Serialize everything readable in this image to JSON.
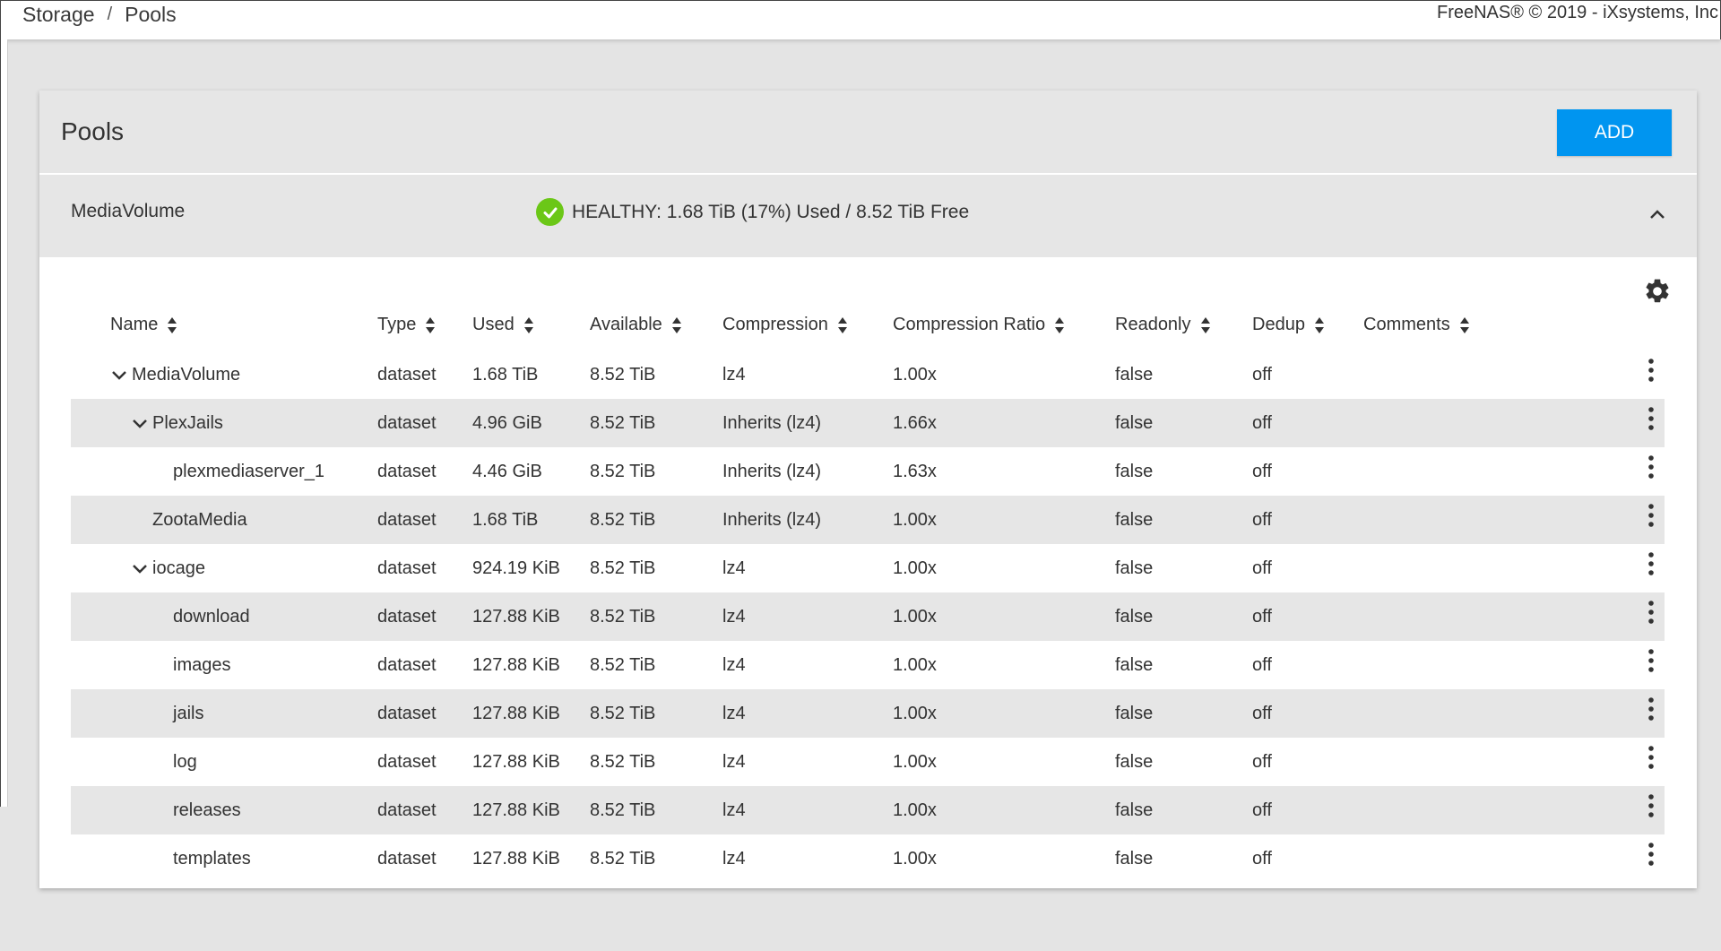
{
  "breadcrumb": {
    "items": [
      "Storage",
      "Pools"
    ],
    "separator": "/"
  },
  "copyright": "FreeNAS® © 2019 - iXsystems, Inc",
  "card": {
    "title": "Pools",
    "add_label": "ADD"
  },
  "pool": {
    "name": "MediaVolume",
    "status": "HEALTHY: 1.68 TiB (17%) Used / 8.52 TiB Free",
    "status_color": "#6bc717"
  },
  "colors": {
    "accent": "#0095f0",
    "header_bg": "#e6e6e6",
    "stripe": "#e6e6e6"
  },
  "columns": [
    "Name",
    "Type",
    "Used",
    "Available",
    "Compression",
    "Compression Ratio",
    "Readonly",
    "Dedup",
    "Comments"
  ],
  "rows": [
    {
      "name": "MediaVolume",
      "level": 0,
      "expander": true,
      "type": "dataset",
      "used": "1.68 TiB",
      "available": "8.52 TiB",
      "compression": "lz4",
      "ratio": "1.00x",
      "readonly": "false",
      "dedup": "off",
      "comments": ""
    },
    {
      "name": "PlexJails",
      "level": 1,
      "expander": true,
      "type": "dataset",
      "used": "4.96 GiB",
      "available": "8.52 TiB",
      "compression": "Inherits (lz4)",
      "ratio": "1.66x",
      "readonly": "false",
      "dedup": "off",
      "comments": ""
    },
    {
      "name": "plexmediaserver_1",
      "level": 2,
      "expander": false,
      "type": "dataset",
      "used": "4.46 GiB",
      "available": "8.52 TiB",
      "compression": "Inherits (lz4)",
      "ratio": "1.63x",
      "readonly": "false",
      "dedup": "off",
      "comments": ""
    },
    {
      "name": "ZootaMedia",
      "level": 1,
      "expander": false,
      "type": "dataset",
      "used": "1.68 TiB",
      "available": "8.52 TiB",
      "compression": "Inherits (lz4)",
      "ratio": "1.00x",
      "readonly": "false",
      "dedup": "off",
      "comments": ""
    },
    {
      "name": "iocage",
      "level": 1,
      "expander": true,
      "type": "dataset",
      "used": "924.19 KiB",
      "available": "8.52 TiB",
      "compression": "lz4",
      "ratio": "1.00x",
      "readonly": "false",
      "dedup": "off",
      "comments": ""
    },
    {
      "name": "download",
      "level": 2,
      "expander": false,
      "type": "dataset",
      "used": "127.88 KiB",
      "available": "8.52 TiB",
      "compression": "lz4",
      "ratio": "1.00x",
      "readonly": "false",
      "dedup": "off",
      "comments": ""
    },
    {
      "name": "images",
      "level": 2,
      "expander": false,
      "type": "dataset",
      "used": "127.88 KiB",
      "available": "8.52 TiB",
      "compression": "lz4",
      "ratio": "1.00x",
      "readonly": "false",
      "dedup": "off",
      "comments": ""
    },
    {
      "name": "jails",
      "level": 2,
      "expander": false,
      "type": "dataset",
      "used": "127.88 KiB",
      "available": "8.52 TiB",
      "compression": "lz4",
      "ratio": "1.00x",
      "readonly": "false",
      "dedup": "off",
      "comments": ""
    },
    {
      "name": "log",
      "level": 2,
      "expander": false,
      "type": "dataset",
      "used": "127.88 KiB",
      "available": "8.52 TiB",
      "compression": "lz4",
      "ratio": "1.00x",
      "readonly": "false",
      "dedup": "off",
      "comments": ""
    },
    {
      "name": "releases",
      "level": 2,
      "expander": false,
      "type": "dataset",
      "used": "127.88 KiB",
      "available": "8.52 TiB",
      "compression": "lz4",
      "ratio": "1.00x",
      "readonly": "false",
      "dedup": "off",
      "comments": ""
    },
    {
      "name": "templates",
      "level": 2,
      "expander": false,
      "type": "dataset",
      "used": "127.88 KiB",
      "available": "8.52 TiB",
      "compression": "lz4",
      "ratio": "1.00x",
      "readonly": "false",
      "dedup": "off",
      "comments": ""
    }
  ],
  "icons": {
    "status": "check-circle-icon",
    "collapse": "chevron-up-icon",
    "settings": "gear-icon",
    "row_menu": "more-vert-icon",
    "sort": "sort-icon",
    "expander": "chevron-down-icon"
  }
}
